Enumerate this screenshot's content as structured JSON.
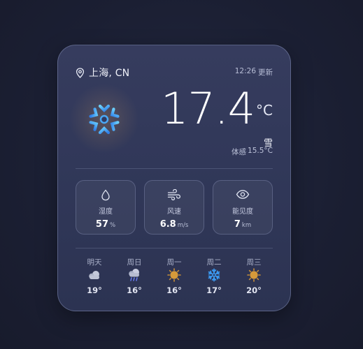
{
  "location": {
    "text": "上海, CN",
    "icon": "map-pin-icon"
  },
  "updated": {
    "time": "12:26",
    "label": "更新"
  },
  "current": {
    "temperature": "17.4",
    "unit": "°C",
    "condition": "雪",
    "feels_label": "体感",
    "feels_value": "15.5°C",
    "icon": "snowflake-icon"
  },
  "stats": [
    {
      "label": "湿度",
      "value": "57",
      "unit": "%",
      "icon": "droplet-icon"
    },
    {
      "label": "风速",
      "value": "6.8",
      "unit": "m/s",
      "icon": "wind-icon"
    },
    {
      "label": "能见度",
      "value": "7",
      "unit": "km",
      "icon": "eye-icon"
    }
  ],
  "forecast": [
    {
      "day": "明天",
      "temp": "19°",
      "icon": "cloud-icon"
    },
    {
      "day": "周日",
      "temp": "16°",
      "icon": "rain-cloud-icon"
    },
    {
      "day": "周一",
      "temp": "16°",
      "icon": "sun-icon"
    },
    {
      "day": "周二",
      "temp": "17°",
      "icon": "snowflake-icon"
    },
    {
      "day": "周三",
      "temp": "20°",
      "icon": "sun-icon"
    }
  ],
  "colors": {
    "background": "#1b1f33",
    "card": "#333a5b",
    "snow_blue": "#3ba3ff",
    "sun": "#d69a3a"
  }
}
